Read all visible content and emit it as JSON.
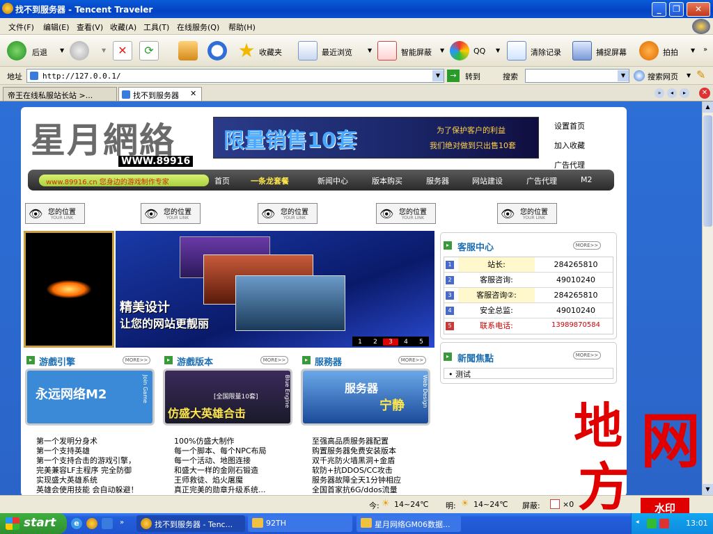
{
  "window": {
    "title": "找不到服务器 - Tencent Traveler"
  },
  "menu": [
    "文件(F)",
    "编辑(E)",
    "查看(V)",
    "收藏(A)",
    "工具(T)",
    "在线服务(Q)",
    "帮助(H)"
  ],
  "toolbar": {
    "back": "后退",
    "favorites": "收藏夹",
    "recent": "最近浏览",
    "smart_block": "智能屏蔽",
    "qq": "QQ",
    "clear": "清除记录",
    "capture": "捕捉屏幕",
    "paipai": "拍拍"
  },
  "address": {
    "label": "地址",
    "url": "http://127.0.0.1/",
    "go": "转到",
    "search_label": "搜索",
    "search_web": "搜索网页"
  },
  "tabs": [
    "帝王在线私服站长站 >...",
    "找不到服务器"
  ],
  "site": {
    "logo_cn": "星月網絡",
    "logo_url": "WWW.89916",
    "banner_main": "限量销售10套",
    "banner_sub1": "为了保护客户的利益",
    "banner_sub2": "我们绝对做到只出售10套",
    "top_links": [
      "设置首页",
      "加入收藏",
      "广告代理"
    ],
    "nav_badge": "www.89916.cn   您身边的游戏制作专家",
    "nav_items": [
      "首页",
      "一条龙套餐",
      "新闻中心",
      "版本购买",
      "服务器",
      "网站建设",
      "广告代理",
      "M2"
    ],
    "eye_label": "您的位置",
    "eye_sub": "YOUR LINK",
    "slide_caption1": "精美设计",
    "slide_caption2": "让您的网站更靓丽",
    "slide_pages": [
      "1",
      "2",
      "3",
      "4",
      "5"
    ],
    "more": "MORE>>",
    "cs_title": "客服中心",
    "cs_rows": [
      {
        "n": "1",
        "label": "站长:",
        "value": "284265810"
      },
      {
        "n": "2",
        "label": "客服咨询:",
        "value": "49010240"
      },
      {
        "n": "3",
        "label": "客服咨询②:",
        "value": "284265810"
      },
      {
        "n": "4",
        "label": "安全总监:",
        "value": "49010240"
      },
      {
        "n": "5",
        "label": "联系电话:",
        "value": "13989870584"
      }
    ],
    "news_title": "新聞焦點",
    "news_items": [
      "测试"
    ],
    "sections": [
      {
        "title": "游戲引擎",
        "img_text": "永远网络M2",
        "side": "Join Game",
        "items": [
          "第一个发明分身术",
          "第一个支持英雄",
          "第一个支持合击的游戏引擎，",
          "完美兼容LF主程序  完全防御",
          "实现盛大英雄系统",
          "英雄会使用技能 会自动躲避！"
        ]
      },
      {
        "title": "游戲版本",
        "img_text": "仿盛大英雄合击",
        "img_badge": "[全国限量10套]",
        "side": "Blue Engine",
        "items": [
          "100%仿盛大制作",
          "每一个脚本、每个NPC布局",
          "每一个活动、地图连接",
          "和盛大一样的金刚石锻造",
          "王师救徒、焰火屠魔",
          "真正完美的勋章升级系统..."
        ]
      },
      {
        "title": "服務器",
        "img_text": "服务器",
        "img_badge": "宁静",
        "side": "Web Design",
        "items": [
          "至强高品质服务器配置",
          "购置服务器免费安装版本",
          "双千兆防火墙黑洞+金盾",
          "软防+抗DDOS/CC攻击",
          "服务器故障全天1分钟相应",
          "全国首家抗6G/ddos流量"
        ]
      }
    ]
  },
  "statusbar": {
    "today": "今:",
    "today_temp": "14~24℃",
    "tomorrow": "明:",
    "tomorrow_temp": "14~24℃",
    "block": "屏蔽:",
    "block_count": "×0"
  },
  "taskbar": {
    "start": "start",
    "tasks": [
      "找不到服务器 - Tenc...",
      "92TH",
      "星月网络GM06数据..."
    ],
    "clock": "13:01"
  },
  "watermark": {
    "chars": "地方网",
    "stamp": "水印"
  },
  "colors": {
    "title_blue": "#0a5bd8",
    "nav_dark": "#3a3a3a",
    "accent_red": "#cc0000",
    "section_blue": "#1e6fb2"
  }
}
